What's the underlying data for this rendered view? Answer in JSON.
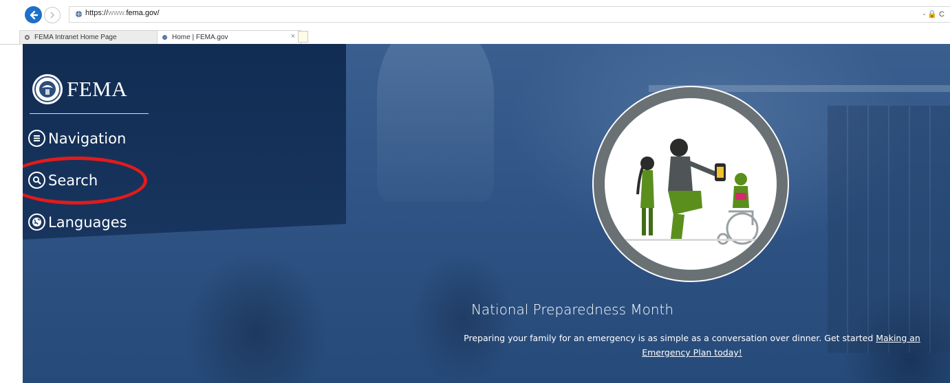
{
  "browser": {
    "url_protocol": "https://",
    "url_host": "www.",
    "url_domain": "fema.gov/",
    "url_right_controls": "- 🔒 C",
    "tabs": [
      {
        "label": "FEMA Intranet Home Page",
        "active": false
      },
      {
        "label": "Home | FEMA.gov",
        "active": true
      }
    ],
    "tab_close": "×"
  },
  "site": {
    "logo_text": "FEMA",
    "nav": {
      "navigation_label": "Navigation",
      "search_label": "Search",
      "languages_label": "Languages"
    }
  },
  "feature": {
    "title": "National Preparedness Month",
    "body_text": "Preparing your family for an emergency is as simple as a conversation over dinner.  Get started ",
    "link_text": "Making an Emergency Plan today!"
  },
  "colors": {
    "highlight": "#e21b1b",
    "page_blue": "#2f5485",
    "back_button": "#1d6fc9",
    "illustration_green": "#5a8f1e"
  }
}
